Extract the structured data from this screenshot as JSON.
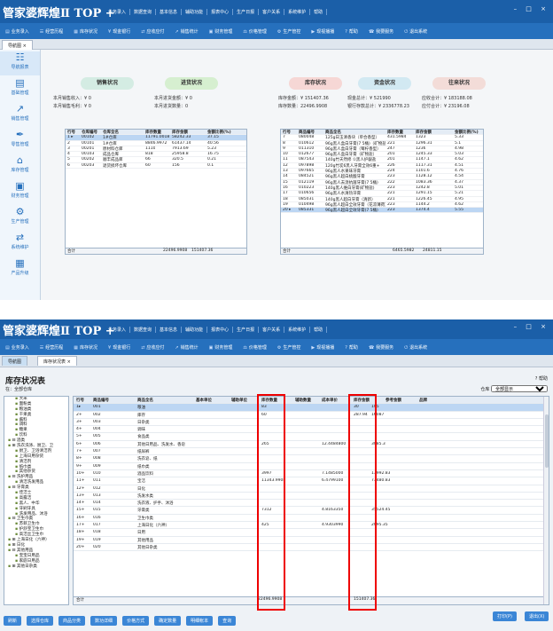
{
  "app": {
    "logo": "管家婆辉煌Ⅱ TOP +",
    "window_controls": "– □ ×"
  },
  "colors": {
    "brand": "#1b5fa8",
    "toolbar": "#2670bd",
    "highlight": "#e00000"
  },
  "menu": [
    "业务录入",
    "数据查询",
    "基本信息",
    "辅助功能",
    "报表中心",
    "生产日报",
    "客户关系",
    "系统维护",
    "帮助"
  ],
  "menu2": [
    "业务录入",
    "数据查询",
    "基本信息",
    "辅助功能",
    "报表中心",
    "生产日报",
    "客户关系",
    "系统维护",
    "帮助"
  ],
  "toolbar1": [
    "业务录入",
    "经营历程",
    "库存状况",
    "现金银行",
    "应收应付",
    "销售统计",
    "财务管理",
    "价格管理",
    "生产管控",
    "现视播播",
    "帮助",
    "我要服务",
    "退出系统"
  ],
  "toolbar2": [
    "业务录入",
    "经营历程",
    "库存状况",
    "现金银行",
    "应收应付",
    "销售统计",
    "财务管理",
    "价格管理",
    "生产管控",
    "现视播播",
    "帮助",
    "我要服务",
    "退出系统"
  ],
  "tabs1": [
    "导航图"
  ],
  "tabs2": [
    "导航图",
    "库存状况表"
  ],
  "leftnav": [
    {
      "icon": "☷",
      "label": "导航报表"
    },
    {
      "icon": "▤",
      "label": "基础管理"
    },
    {
      "icon": "↗",
      "label": "销售管理"
    },
    {
      "icon": "✒",
      "label": "零售管理"
    },
    {
      "icon": "⌂",
      "label": "库存管理"
    },
    {
      "icon": "▣",
      "label": "财务管理"
    },
    {
      "icon": "⚙",
      "label": "生产管理"
    },
    {
      "icon": "⇄",
      "label": "系统维护"
    },
    {
      "icon": "▦",
      "label": "产品升级"
    }
  ],
  "cards": [
    {
      "title": "销售状况",
      "color": "#d4ece3",
      "lines": [
        "本月销售收入：¥ 0",
        "本月销售毛利：¥ 0"
      ]
    },
    {
      "title": "进货状况",
      "color": "#d6efd0",
      "lines": [
        "本月进货金额：¥ 0",
        "本月进货数量：0"
      ]
    },
    {
      "title": "库存状况",
      "color": "#f6d7d5",
      "lines": [
        "库存金额：¥ 151407.36",
        "库存数量：22496.9908"
      ]
    },
    {
      "title": "资金状况",
      "color": "#d2e9f2",
      "lines": [
        "现金总计：¥ 521990",
        "银行存款总计：¥ 2336778.23"
      ]
    },
    {
      "title": "往来状况",
      "color": "#f3dcd8",
      "lines": [
        "应收合计：¥ 183188.08",
        "应付合计：¥ 23196.08"
      ]
    }
  ],
  "wh_table": {
    "headers": [
      "行号",
      "仓库编号",
      "仓库全名",
      "库存数量",
      "库存金额",
      "金额比例(%)"
    ],
    "rows": [
      [
        "1 ▸",
        "00102",
        "1#仓库",
        "11791.0018",
        "58242.33",
        "37.15"
      ],
      [
        "2",
        "00101",
        "1#仓库",
        "8846.9972",
        "61437.14",
        "40.56"
      ],
      [
        "3",
        "00201",
        "原材料仓库",
        "1110",
        "7913.69",
        "5.23"
      ],
      [
        "4",
        "00103",
        "成品仓库",
        "818",
        "25958.8",
        "16.75"
      ],
      [
        "5",
        "00202",
        "顺丰成品库",
        "66",
        "320.5",
        "0.21"
      ],
      [
        "6",
        "00203",
        "退货损坏仓库",
        "60",
        "156",
        "0.1"
      ]
    ],
    "footer": {
      "label": "合计",
      "qty": "22496.9908",
      "amt": "151407.36"
    }
  },
  "prod_table": {
    "headers": [
      "行号",
      "商品编号",
      "商品全名",
      "库存数量",
      "库存金额",
      "金额比例(%)"
    ],
    "rows": [
      [
        "7",
        "080048",
        "125g日玉清香块（单合香型）",
        "431.5984",
        "1323",
        "5.33"
      ],
      [
        "8",
        "010612",
        "96g黑人盒白牙膏(7 5桶)（矿物盐）",
        "221",
        "1296.31",
        "5.1"
      ],
      [
        "9",
        "011310",
        "96g黑人盒白牙膏（莓柠香型）",
        "247",
        "1236",
        "4.98"
      ],
      [
        "10",
        "012677",
        "96g黑人盒白牙膏（矿物盐）",
        "201",
        "1245.33",
        "5.03"
      ],
      [
        "11",
        "087543",
        "140g竹天然修 ①黑人护龈盐",
        "201",
        "1147.1",
        "4.62"
      ],
      [
        "12",
        "097898",
        "120g竹炭6黑人牙膏全效6重+",
        "226",
        "1117.31",
        "4.51"
      ],
      [
        "13",
        "097665",
        "96g黑人水果味牙膏",
        "224",
        "1101.6",
        "4.76"
      ],
      [
        "14",
        "084521",
        "96g黑人超白桃酸牙膏",
        "223",
        "1128.12",
        "4.54"
      ],
      [
        "15",
        "012119",
        "96g黑人去渍抗菌牙膏(7 5桶)",
        "222",
        "1083.36",
        "4.37"
      ],
      [
        "16",
        "010223",
        "140g黑人维白牙膏(矿物盐)",
        "223",
        "1242.8",
        "5.01"
      ],
      [
        "17",
        "010656",
        "96g黑人水清热牙膏",
        "221",
        "1291.15",
        "5.21"
      ],
      [
        "18",
        "085031",
        "140g黑人超白牙膏（清新）",
        "221",
        "1226.45",
        "4.95"
      ],
      [
        "19",
        "010498",
        "96g黑人超白全效牙膏（花凉薄荷）",
        "223",
        "1144.2",
        "4.62"
      ],
      [
        "20 ▸",
        "085331",
        "96g黑人超白全效牙膏(7 5桶)",
        "223",
        "1374.4",
        "5.55"
      ]
    ],
    "footer": {
      "label": "合计",
      "qty": "6465.5982",
      "amt": "24811.15"
    }
  },
  "report": {
    "title": "库存状况表",
    "crumb_label": "在",
    "crumb_value": "全部仓库",
    "help_label": "帮助",
    "filter_label": "仓库",
    "filter_value": "全部显示",
    "tree": [
      {
        "t": "大米",
        "lvl": "l2"
      },
      {
        "t": "面粉类",
        "lvl": "l2"
      },
      {
        "t": "粮油类",
        "lvl": "l2"
      },
      {
        "t": "干果类",
        "lvl": "l2"
      },
      {
        "t": "酱料",
        "lvl": "l2"
      },
      {
        "t": "调料",
        "lvl": "l2"
      },
      {
        "t": "糖果",
        "lvl": "l2"
      },
      {
        "t": "饮料",
        "lvl": "l2"
      },
      {
        "t": "⊟ 酒类",
        "lvl": "l1"
      },
      {
        "t": "⊞ 洗衣洗涤、厨卫、卫",
        "lvl": "l1"
      },
      {
        "t": "厨卫、卫浴清洁剂",
        "lvl": "l2"
      },
      {
        "t": "上海日用杂货",
        "lvl": "l2"
      },
      {
        "t": "清洁剂",
        "lvl": "l2"
      },
      {
        "t": "纸巾类",
        "lvl": "l2"
      },
      {
        "t": "其他杂货",
        "lvl": "l2"
      },
      {
        "t": "⊟ 洗护用品",
        "lvl": "l1"
      },
      {
        "t": "清洁洗发用品",
        "lvl": "l2"
      },
      {
        "t": "⊟ 牙膏类",
        "lvl": "l1"
      },
      {
        "t": "佳洁士",
        "lvl": "l2"
      },
      {
        "t": "高露洁",
        "lvl": "l2"
      },
      {
        "t": "黑人、中华",
        "lvl": "l2"
      },
      {
        "t": "牙刷牙具",
        "lvl": "l2"
      },
      {
        "t": "洗发用品、沐浴",
        "lvl": "l2"
      },
      {
        "t": "⊟ 卫生巾类",
        "lvl": "l1"
      },
      {
        "t": "苏菲卫生巾",
        "lvl": "l2"
      },
      {
        "t": "护舒宝卫生巾",
        "lvl": "l2"
      },
      {
        "t": "高洁丝卫生巾",
        "lvl": "l2"
      },
      {
        "t": "⊞ 上海日化（六神）",
        "lvl": "l1"
      },
      {
        "t": "⊞ 日化",
        "lvl": "l1"
      },
      {
        "t": "⊟ 其他用品",
        "lvl": "l1"
      },
      {
        "t": "宝宝日用品",
        "lvl": "l2"
      },
      {
        "t": "家庭日用品",
        "lvl": "l2"
      },
      {
        "t": "⊞ 其他日杂类",
        "lvl": "l1"
      }
    ],
    "headers": [
      "行号",
      "商品编号",
      "商品全名",
      "基本单位",
      "辅助单位",
      "库存数量",
      "辅助数量",
      "成本单价",
      "库存金额",
      "参考金额",
      "品牌"
    ],
    "rows": [
      [
        "1▸",
        "001",
        "粮油",
        "",
        "",
        "83",
        "",
        "",
        "30",
        "105"
      ],
      [
        "2+",
        "002",
        "库存",
        "",
        "",
        "60",
        "",
        "",
        "287.94",
        "16087"
      ],
      [
        "3+",
        "003",
        "日杂类",
        "",
        "",
        "",
        "",
        "",
        "",
        ""
      ],
      [
        "4+",
        "004",
        "调味",
        "",
        "",
        "",
        "",
        "",
        "",
        ""
      ],
      [
        "5+",
        "005",
        "食品类",
        "",
        "",
        "",
        "",
        "",
        "",
        ""
      ],
      [
        "6+",
        "006",
        "其他日用品、洗发水、香皂",
        "",
        "",
        "265",
        "",
        "12.4484800",
        "",
        "3085.3"
      ],
      [
        "7+",
        "007",
        "纸尿裤",
        "",
        "",
        "",
        "",
        "",
        "",
        ""
      ],
      [
        "8+",
        "008",
        "洗衣皂、纸",
        "",
        "",
        "",
        "",
        "",
        "",
        ""
      ],
      [
        "9+",
        "009",
        "纸巾类",
        "",
        "",
        "",
        "",
        "",
        "",
        ""
      ],
      [
        "10+",
        "010",
        "酒品饮料",
        "",
        "",
        "3997",
        "",
        "7.1485000",
        "",
        "13992.83"
      ],
      [
        "11+",
        "011",
        "宝洁",
        "",
        "",
        "11343.9908",
        "",
        "6.4799100",
        "",
        "73480.83"
      ],
      [
        "12+",
        "012",
        "日化",
        "",
        "",
        "",
        "",
        "",
        "",
        ""
      ],
      [
        "13+",
        "013",
        "洗发水类",
        "",
        "",
        "",
        "",
        "",
        "",
        ""
      ],
      [
        "14+",
        "014",
        "洗衣液、护手、沐浴",
        "",
        "",
        "",
        "",
        "",
        "",
        ""
      ],
      [
        "15+",
        "015",
        "牙膏类",
        "",
        "",
        "7312",
        "",
        "4.8163350",
        "",
        "35524.45"
      ],
      [
        "16+",
        "016",
        "卫生巾类",
        "",
        "",
        "",
        "",
        "",
        "",
        ""
      ],
      [
        "17+",
        "017",
        "上海日化（六神）",
        "",
        "",
        "425",
        "",
        "4.9303990",
        "",
        "2095.35"
      ],
      [
        "18+",
        "018",
        "日用",
        "",
        "",
        "",
        "",
        "",
        "",
        ""
      ],
      [
        "19+",
        "019",
        "其他用品",
        "",
        "",
        "",
        "",
        "",
        "",
        ""
      ],
      [
        "20+",
        "020",
        "其他日杂类",
        "",
        "",
        "",
        "",
        "",
        "",
        ""
      ]
    ],
    "footer": {
      "label": "合计",
      "qty": "22496.9908",
      "amt": "151407.36"
    },
    "buttons": [
      "刷新",
      "选择仓库",
      "商品分类",
      "数功详细",
      "价格方式",
      "确定数量",
      "明细帐本",
      "查询"
    ],
    "btn_print": "打印(P)",
    "btn_exit": "退出(X)"
  }
}
